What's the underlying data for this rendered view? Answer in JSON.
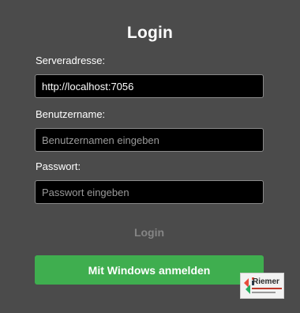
{
  "title": "Login",
  "server": {
    "label": "Serveradresse:",
    "value": "http://localhost:7056"
  },
  "username": {
    "label": "Benutzername:",
    "placeholder": "Benutzernamen eingeben",
    "value": ""
  },
  "password": {
    "label": "Passwort:",
    "placeholder": "Passwort eingeben",
    "value": ""
  },
  "buttons": {
    "login_label": "Login",
    "windows_label": "Mit Windows anmelden"
  },
  "watermark": {
    "logo_text": "Riemer"
  },
  "colors": {
    "background": "#4b4b4b",
    "field_background": "#000000",
    "windows_button": "#3fae4f",
    "login_disabled_text": "#858585"
  }
}
